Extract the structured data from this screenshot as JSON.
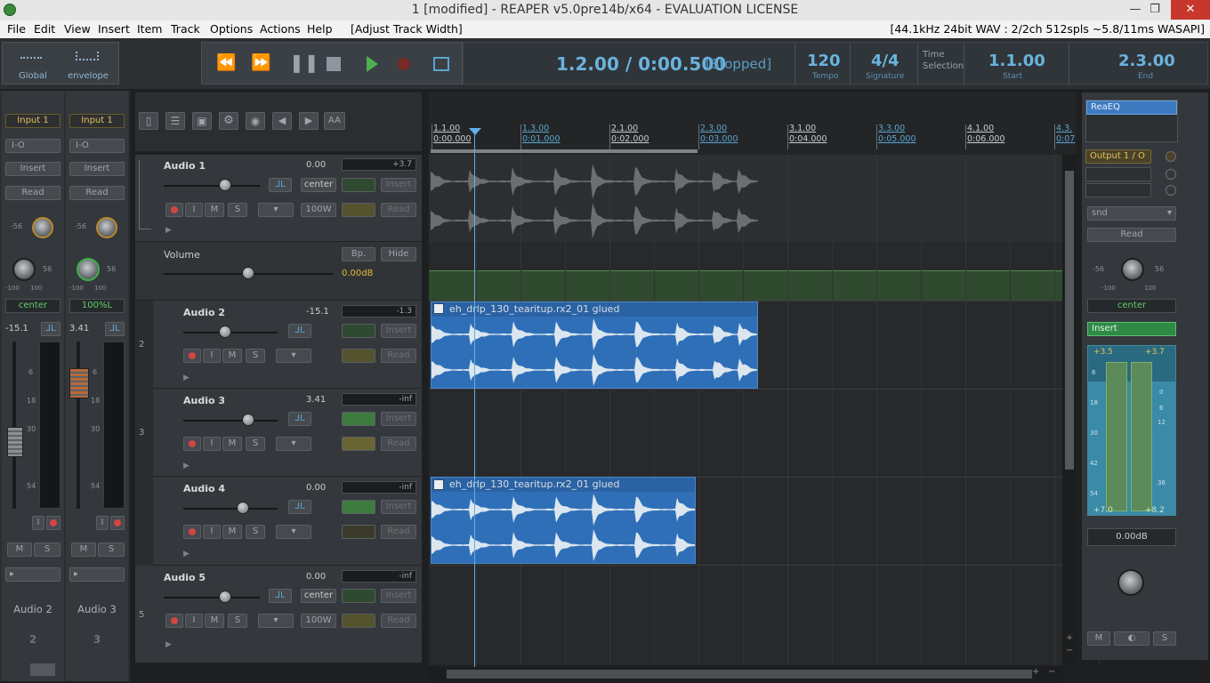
{
  "window": {
    "title": "1 [modified] - REAPER v5.0pre14b/x64 - EVALUATION LICENSE",
    "min_glyph": "—",
    "max_glyph": "❐",
    "close_glyph": "✕"
  },
  "menu": {
    "items": [
      "File",
      "Edit",
      "View",
      "Insert",
      "Item",
      "Track",
      "Options",
      "Actions",
      "Help",
      "[Adjust Track Width]"
    ],
    "status": "[44.1kHz 24bit WAV : 2/2ch 512spls ~5.8/11ms WASAPI]"
  },
  "toolbar": {
    "global_label": "Global",
    "envelope_label": "envelope",
    "position": "1.2.00 / 0:00.500",
    "state": "[Stopped]",
    "tempo_value": "120",
    "tempo_label": "Tempo",
    "signature_value": "4/4",
    "signature_label": "Signature",
    "time_sel_label1": "Time",
    "time_sel_label2": "Selection",
    "start_value": "1.1.00",
    "start_label": "Start",
    "end_value": "2.3.00",
    "end_label": "End"
  },
  "mixer_left": {
    "strips": [
      {
        "input": "Input 1",
        "io": "I-O",
        "insert": "Insert",
        "read": "Read",
        "pan": "center",
        "vol": "-15.1",
        "name": "Audio 2",
        "num": "2"
      },
      {
        "input": "Input 1",
        "io": "I-O",
        "insert": "Insert",
        "read": "Read",
        "pan": "100%L",
        "vol": "3.41",
        "name": "Audio 3",
        "num": "3"
      }
    ],
    "knob_low": "-56",
    "knob_high": "56",
    "knob_min": "-100",
    "knob_max": "100",
    "scale": [
      "6",
      "18",
      "30",
      "54"
    ],
    "m_label": "M",
    "s_label": "S",
    "i_label": "I"
  },
  "tcp_toolbar": {
    "aa_label": "AA"
  },
  "tracks": [
    {
      "name": "Audio 1",
      "vol": "0.00",
      "meter": "+3.7",
      "pan": "center",
      "width": "100W",
      "insert": "Insert",
      "read": "Read",
      "num": ""
    },
    {
      "name": "Audio 2",
      "vol": "-15.1",
      "meter": "-1.3",
      "insert": "Insert",
      "read": "Read",
      "num": "2"
    },
    {
      "name": "Audio 3",
      "vol": "3.41",
      "meter": "-inf",
      "insert": "Insert",
      "read": "Read",
      "num": "3"
    },
    {
      "name": "Audio 4",
      "vol": "0.00",
      "meter": "-inf",
      "insert": "Insert",
      "read": "Read",
      "num": ""
    },
    {
      "name": "Audio 5",
      "vol": "0.00",
      "meter": "-inf",
      "pan": "center",
      "width": "100W",
      "insert": "Insert",
      "read": "Read",
      "num": "5"
    }
  ],
  "envelope": {
    "name": "Volume",
    "bp": "Bp.",
    "hide": "Hide",
    "value": "0.00dB"
  },
  "ruler": {
    "bars": [
      "1.1.00",
      "1.3.00",
      "2.1.00",
      "2.3.00",
      "3.1.00",
      "3.3.00",
      "4.1.00",
      "4.3."
    ],
    "times": [
      "0:00.000",
      "0:01.000",
      "0:02.000",
      "0:03.000",
      "0:04.000",
      "0:05.000",
      "0:06.000",
      "0:07"
    ]
  },
  "clips": [
    {
      "label": "eh_drlp_130_tearitup.rx2_01 glued"
    },
    {
      "label": "eh_drlp_130_tearitup.rx2_01 glued"
    }
  ],
  "master": {
    "fx": "ReaEQ",
    "output": "Output 1 / O",
    "send": "snd",
    "read": "Read",
    "knob_low": "-56",
    "knob_high": "56",
    "knob_min": "-100",
    "knob_max": "100",
    "pan": "center",
    "insert": "Insert",
    "peak_l": "+3.5",
    "peak_r": "+3.7",
    "low_l": "+7.0",
    "low_r": "+8.2",
    "scale_left": [
      "6",
      "18",
      "30",
      "42",
      "54"
    ],
    "scale_right": [
      "0",
      "6",
      "12",
      "36"
    ],
    "vol": "0.00dB",
    "m_label": "M",
    "s_label": "S"
  },
  "scroll": {
    "plus": "+",
    "minus": "−"
  }
}
